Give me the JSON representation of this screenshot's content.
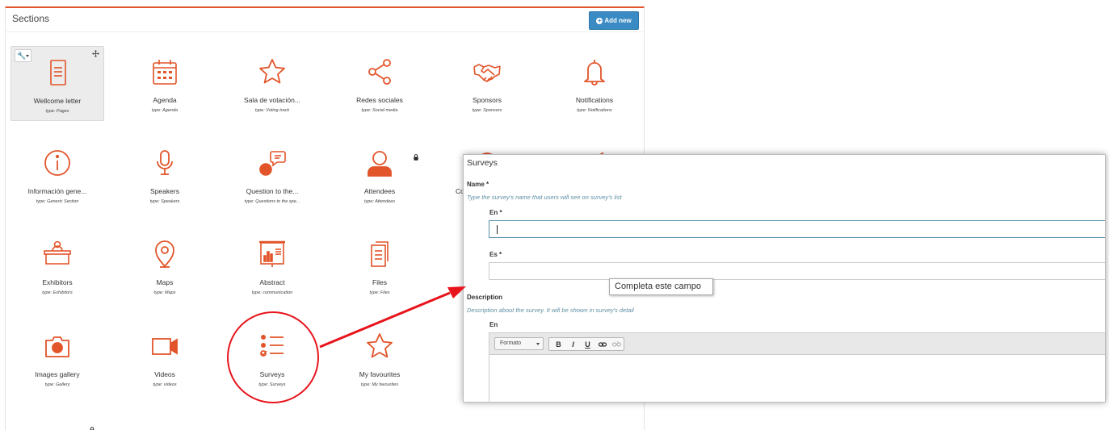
{
  "sections": {
    "title": "Sections",
    "add_new_label": "Add new",
    "tiles": [
      {
        "name": "Wellcome letter",
        "type": "type: Pages",
        "icon": "document-icon",
        "selected": true,
        "locked": false
      },
      {
        "name": "Agenda",
        "type": "type: Agenda",
        "icon": "calendar-icon",
        "locked": false
      },
      {
        "name": "Sala de votación...",
        "type": "type: Voting track",
        "icon": "star-icon",
        "locked": false
      },
      {
        "name": "Redes sociales",
        "type": "type: Social media",
        "icon": "share-icon",
        "locked": false
      },
      {
        "name": "Sponsors",
        "type": "type: Sponsors",
        "icon": "handshake-icon",
        "locked": false
      },
      {
        "name": "Notifications",
        "type": "type: Notifications",
        "icon": "bell-icon",
        "locked": false
      },
      {
        "name": "Información gene...",
        "type": "type: Generic Section",
        "icon": "info-icon",
        "locked": false
      },
      {
        "name": "Speakers",
        "type": "type: Speakers",
        "icon": "microphone-icon",
        "locked": false
      },
      {
        "name": "Question to the...",
        "type": "type: Questions to the spe...",
        "icon": "question-bubble-icon",
        "locked": false
      },
      {
        "name": "Attendees",
        "type": "type: Attendees",
        "icon": "person-icon",
        "locked": true
      },
      {
        "name": "Co",
        "type": "",
        "icon": "partial-icon",
        "locked": true
      },
      {
        "name": "",
        "type": "",
        "icon": "megaphone-icon",
        "locked": true
      },
      {
        "name": "Exhibitors",
        "type": "type: Exhibitors",
        "icon": "exhibitor-icon",
        "locked": false
      },
      {
        "name": "Maps",
        "type": "type: Maps",
        "icon": "map-pin-icon",
        "locked": false
      },
      {
        "name": "Abstract",
        "type": "type: communication",
        "icon": "presentation-icon",
        "locked": false
      },
      {
        "name": "Files",
        "type": "type: Files",
        "icon": "files-icon",
        "locked": false
      },
      {
        "name": "Images gallery",
        "type": "type: Gallery",
        "icon": "camera-icon",
        "locked": false
      },
      {
        "name": "Videos",
        "type": "type: videos",
        "icon": "video-camera-icon",
        "locked": false
      },
      {
        "name": "Surveys",
        "type": "type: Surveys",
        "icon": "survey-list-icon",
        "locked": false
      },
      {
        "name": "My favourites",
        "type": "type: My favourites",
        "icon": "star-icon",
        "locked": false
      }
    ]
  },
  "dialog": {
    "title": "Surveys",
    "name_label": "Name *",
    "name_help": "Type the survey's name that users will see on survey's list",
    "en_label": "En *",
    "es_label": "Es *",
    "en_value": "",
    "es_value": "",
    "description_label": "Description",
    "description_help": "Description about the survey. It will be shown in survey's detail",
    "description_en_label": "En",
    "format_select": "Formato",
    "format_buttons": [
      "B",
      "I",
      "U"
    ]
  },
  "tooltip": "Completa este campo",
  "colors": {
    "accent": "#e2542a",
    "add_button": "#3a8ac3",
    "help_text": "#5f8fa2",
    "annotation": "#e8141c"
  }
}
